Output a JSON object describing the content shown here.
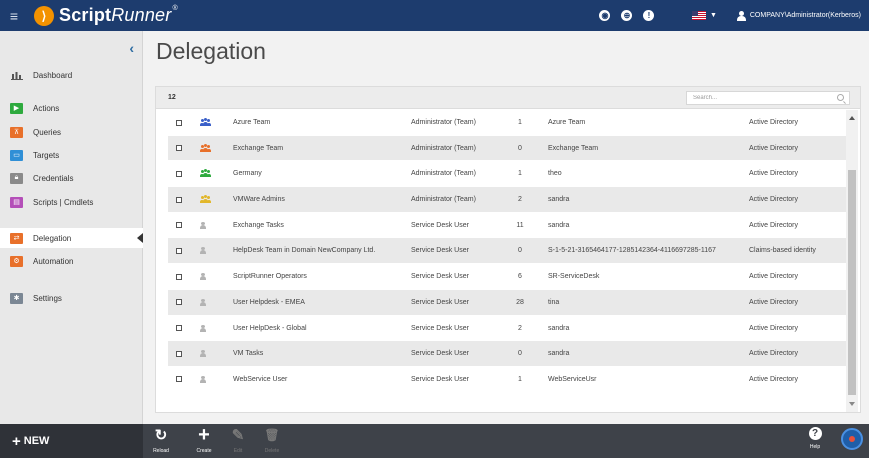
{
  "app": {
    "brand_main": "Script",
    "brand_runner": "Runner",
    "brand_mark": "®",
    "user": "COMPANY\\Administrator(Kerberos)"
  },
  "sidebar": {
    "items": [
      {
        "label": "Dashboard",
        "icon": "bar-chart-icon",
        "color": "#555555"
      },
      {
        "label": "Actions",
        "icon": "play-icon",
        "color": "#2eaa3e"
      },
      {
        "label": "Queries",
        "icon": "queries-icon",
        "color": "#e8702a"
      },
      {
        "label": "Targets",
        "icon": "monitor-icon",
        "color": "#2f8fd6"
      },
      {
        "label": "Credentials",
        "icon": "lock-icon",
        "color": "#8a8a8a"
      },
      {
        "label": "Scripts | Cmdlets",
        "icon": "script-icon",
        "color": "#b44fb8"
      },
      {
        "label": "Delegation",
        "icon": "delegation-icon",
        "color": "#e8702a",
        "active": true
      },
      {
        "label": "Automation",
        "icon": "automation-icon",
        "color": "#e8702a"
      },
      {
        "label": "Settings",
        "icon": "gear-icon",
        "color": "#7b8794"
      }
    ]
  },
  "page": {
    "title": "Delegation",
    "count": "12",
    "search_placeholder": "Search..."
  },
  "table": {
    "rows": [
      {
        "name": "Azure Team",
        "role": "Administrator (Team)",
        "count": "1",
        "user": "Azure Team",
        "type": "Active Directory",
        "icon": "team-icon",
        "color": "#3a5fc8"
      },
      {
        "name": "Exchange Team",
        "role": "Administrator (Team)",
        "count": "0",
        "user": "Exchange Team",
        "type": "Active Directory",
        "icon": "team-icon",
        "color": "#e8702a"
      },
      {
        "name": "Germany",
        "role": "Administrator (Team)",
        "count": "1",
        "user": "theo",
        "type": "Active Directory",
        "icon": "team-icon",
        "color": "#2eaa3e"
      },
      {
        "name": "VMWare Admins",
        "role": "Administrator (Team)",
        "count": "2",
        "user": "sandra",
        "type": "Active Directory",
        "icon": "team-icon",
        "color": "#e2b72a"
      },
      {
        "name": "Exchange Tasks",
        "role": "Service Desk User",
        "count": "11",
        "user": "sandra",
        "type": "Active Directory",
        "icon": "user-icon",
        "color": "#b3b3b3"
      },
      {
        "name": "HelpDesk Team in Domain NewCompany Ltd.",
        "role": "Service Desk User",
        "count": "0",
        "user": "S-1-5-21-3165464177-1285142364-4116697285-1167",
        "type": "Claims-based identity",
        "icon": "user-icon",
        "color": "#b3b3b3"
      },
      {
        "name": "ScriptRunner Operators",
        "role": "Service Desk User",
        "count": "6",
        "user": "SR-ServiceDesk",
        "type": "Active Directory",
        "icon": "user-icon",
        "color": "#b3b3b3"
      },
      {
        "name": "User Helpdesk - EMEA",
        "role": "Service Desk User",
        "count": "28",
        "user": "tina",
        "type": "Active Directory",
        "icon": "user-icon",
        "color": "#b3b3b3"
      },
      {
        "name": "User HelpDesk - Global",
        "role": "Service Desk User",
        "count": "2",
        "user": "sandra",
        "type": "Active Directory",
        "icon": "user-icon",
        "color": "#b3b3b3"
      },
      {
        "name": "VM Tasks",
        "role": "Service Desk User",
        "count": "0",
        "user": "sandra",
        "type": "Active Directory",
        "icon": "user-icon",
        "color": "#b3b3b3"
      },
      {
        "name": "WebService User",
        "role": "Service Desk User",
        "count": "1",
        "user": "WebServiceUsr",
        "type": "Active Directory",
        "icon": "user-icon",
        "color": "#b3b3b3"
      }
    ]
  },
  "bottombar": {
    "new_label": "NEW",
    "tools": [
      {
        "label": "Reload",
        "icon": "reload-icon",
        "glyph": "↻",
        "enabled": true
      },
      {
        "label": "Create",
        "icon": "plus-icon",
        "glyph": "+",
        "enabled": true
      },
      {
        "label": "Edit",
        "icon": "pencil-icon",
        "glyph": "✎",
        "enabled": false
      },
      {
        "label": "Delete",
        "icon": "trash-icon",
        "glyph": "🗑",
        "enabled": false
      }
    ],
    "help_label": "Help"
  }
}
